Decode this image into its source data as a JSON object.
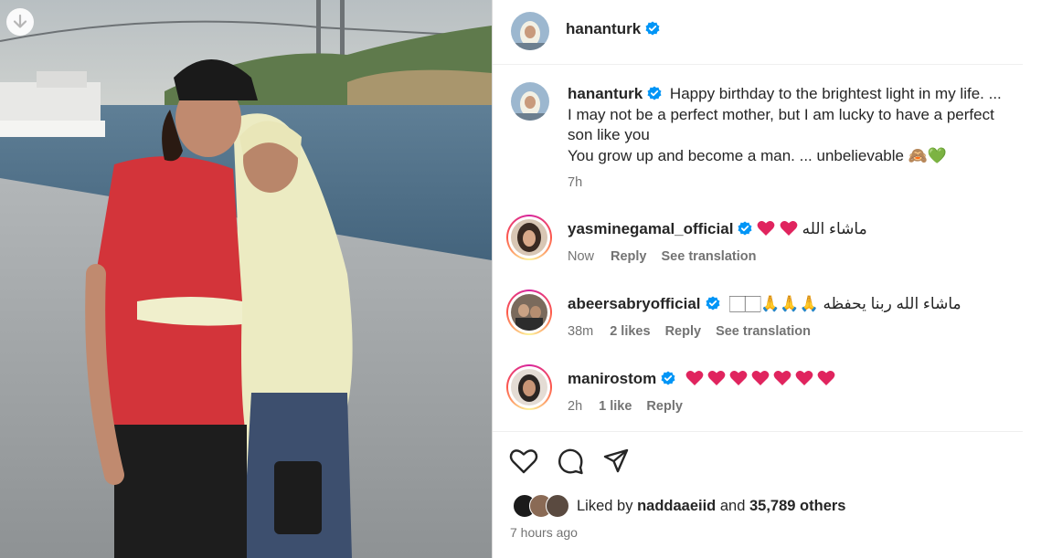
{
  "post": {
    "username": "hananturk",
    "caption_lines": [
      "Happy birthday to the brightest light in my life. ...",
      "I may not be a perfect mother, but I am lucky to have a perfect",
      "son like you",
      "You grow up and become a man. ... unbelievable"
    ],
    "caption_emoji": [
      "🙈",
      "💚"
    ],
    "caption_time": "7h"
  },
  "comments": [
    {
      "username": "yasminegamal_official",
      "text": "ماشاء الله",
      "emoji": [
        "heart",
        "heart"
      ],
      "time": "Now",
      "likes": "",
      "reply": "Reply",
      "translate": "See translation"
    },
    {
      "username": "abeersabryofficial",
      "text": "ماشاء الله ربنا يحفظه",
      "emoji_prefix": "🏻🏻",
      "emoji": [
        "🙏",
        "🙏",
        "🙏"
      ],
      "time": "38m",
      "likes": "2 likes",
      "reply": "Reply",
      "translate": "See translation"
    },
    {
      "username": "manirostom",
      "text": "",
      "emoji": [
        "heart",
        "heart",
        "heart",
        "heart",
        "heart",
        "heart",
        "heart"
      ],
      "time": "2h",
      "likes": "1 like",
      "reply": "Reply",
      "translate": ""
    }
  ],
  "footer": {
    "liked_by_prefix": "Liked by",
    "liked_by_user": "naddaaeiid",
    "and": "and",
    "others": "35,789 others",
    "posted": "7 hours ago"
  },
  "icons": [
    "download-icon",
    "verified-icon",
    "heart-outline-icon",
    "comment-icon",
    "share-icon"
  ],
  "colors": {
    "verified": "#0095f6",
    "heart": "#e0245e",
    "muted": "#737373"
  }
}
